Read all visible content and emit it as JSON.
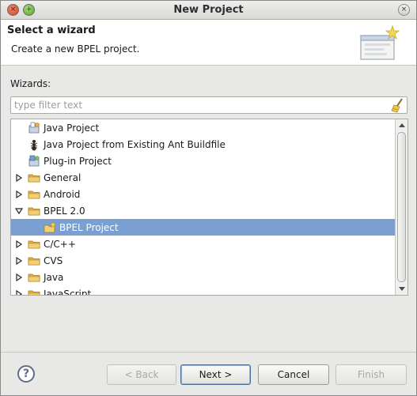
{
  "window": {
    "title": "New Project",
    "close_glyph": "×",
    "max_glyph": "+",
    "right_glyph": "×"
  },
  "header": {
    "title": "Select a wizard",
    "description": "Create a new BPEL project.",
    "icon": "wizard-banner-icon"
  },
  "wizards": {
    "label": "Wizards:",
    "filter_placeholder": "type filter text",
    "filter_value": "",
    "filter_icon": "clear-broom-icon"
  },
  "tree": {
    "items": [
      {
        "label": "Java Project",
        "expand": "none",
        "icon": "java-project-icon",
        "level": 0
      },
      {
        "label": "Java Project from Existing Ant Buildfile",
        "expand": "none",
        "icon": "ant-icon",
        "level": 0
      },
      {
        "label": "Plug-in Project",
        "expand": "none",
        "icon": "plugin-project-icon",
        "level": 0
      },
      {
        "label": "General",
        "expand": "collapsed",
        "icon": "folder-icon",
        "level": 0
      },
      {
        "label": "Android",
        "expand": "collapsed",
        "icon": "folder-icon",
        "level": 0
      },
      {
        "label": "BPEL 2.0",
        "expand": "expanded",
        "icon": "folder-icon",
        "level": 0
      },
      {
        "label": "BPEL Project",
        "expand": "none",
        "icon": "bpel-project-icon",
        "level": 1,
        "selected": true
      },
      {
        "label": "C/C++",
        "expand": "collapsed",
        "icon": "folder-icon",
        "level": 0
      },
      {
        "label": "CVS",
        "expand": "collapsed",
        "icon": "folder-icon",
        "level": 0
      },
      {
        "label": "Java",
        "expand": "collapsed",
        "icon": "folder-icon",
        "level": 0
      },
      {
        "label": "JavaScript",
        "expand": "collapsed",
        "icon": "folder-icon",
        "level": 0
      }
    ]
  },
  "footer": {
    "help_glyph": "?",
    "back_label": "< Back",
    "next_label": "Next >",
    "cancel_label": "Cancel",
    "finish_label": "Finish"
  },
  "colors": {
    "selection": "#7aa0d2",
    "folder": "#e0b04a"
  }
}
